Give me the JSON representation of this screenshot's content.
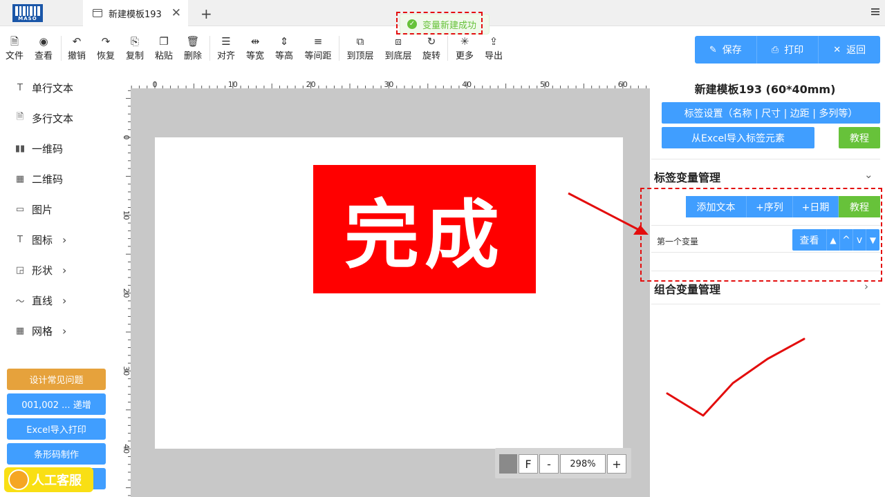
{
  "tabbar": {
    "logo_text": "MASO",
    "tab_title": "新建模板193",
    "tab_close": "✕",
    "add_tab": "+"
  },
  "toast": {
    "message": "变量新建成功"
  },
  "toolbar": {
    "items": [
      {
        "label": "文件",
        "icon": "file-icon"
      },
      {
        "label": "查看",
        "icon": "eye-icon"
      },
      {
        "label": "撤销",
        "icon": "undo-icon"
      },
      {
        "label": "恢复",
        "icon": "redo-icon"
      },
      {
        "label": "复制",
        "icon": "copy-icon"
      },
      {
        "label": "粘贴",
        "icon": "paste-icon"
      },
      {
        "label": "删除",
        "icon": "trash-icon"
      },
      {
        "label": "对齐",
        "icon": "align-icon"
      },
      {
        "label": "等宽",
        "icon": "equal-width-icon"
      },
      {
        "label": "等高",
        "icon": "equal-height-icon"
      },
      {
        "label": "等间距",
        "icon": "equal-spacing-icon"
      },
      {
        "label": "到顶层",
        "icon": "bring-front-icon"
      },
      {
        "label": "到底层",
        "icon": "send-back-icon"
      },
      {
        "label": "旋转",
        "icon": "rotate-icon"
      },
      {
        "label": "更多",
        "icon": "more-icon"
      },
      {
        "label": "导出",
        "icon": "export-icon"
      }
    ],
    "save": "保存",
    "print": "打印",
    "back": "返回"
  },
  "sidebar": {
    "items": [
      {
        "label": "单行文本",
        "icon": "text-icon"
      },
      {
        "label": "多行文本",
        "icon": "multiline-text-icon"
      },
      {
        "label": "一维码",
        "icon": "barcode-icon"
      },
      {
        "label": "二维码",
        "icon": "qrcode-icon"
      },
      {
        "label": "图片",
        "icon": "image-icon"
      },
      {
        "label": "图标",
        "icon": "icon-icon",
        "chevron": "›"
      },
      {
        "label": "形状",
        "icon": "shape-icon",
        "chevron": "›"
      },
      {
        "label": "直线",
        "icon": "line-icon",
        "chevron": "›"
      },
      {
        "label": "网格",
        "icon": "grid-icon",
        "chevron": "›"
      }
    ],
    "buttons": [
      "设计常见问题",
      "001,002 ... 递增",
      "Excel导入打印",
      "条形码制作"
    ],
    "support": "人工客服"
  },
  "canvas": {
    "ruler_top": [
      "0",
      "10",
      "20",
      "30",
      "40",
      "50",
      "60"
    ],
    "ruler_left": [
      "0",
      "10",
      "20",
      "30",
      "40"
    ],
    "label_text": "完成",
    "zoom": {
      "f": "F",
      "minus": "-",
      "value": "298%",
      "plus": "+"
    }
  },
  "rpanel": {
    "title": "新建模板193 (60*40mm)",
    "settings_btn": "标签设置（名称 | 尺寸 | 边距 | 多列等）",
    "excel_btn": "从Excel导入标签元素",
    "tutorial": "教程",
    "var_section": "标签变量管理",
    "var_buttons": {
      "add_text": "添加文本",
      "seq": "+序列",
      "date": "+日期",
      "tutorial": "教程"
    },
    "variable": {
      "name": "第一个变量",
      "view": "查看",
      "up_fill": "▲",
      "up": "^",
      "down": "v",
      "down_fill": "▼"
    },
    "combo_section": "组合变量管理"
  },
  "colors": {
    "primary": "#409eff",
    "green": "#67c23a",
    "orange": "#e6a23c",
    "red": "#ff0000",
    "annot": "#e30d0d"
  }
}
